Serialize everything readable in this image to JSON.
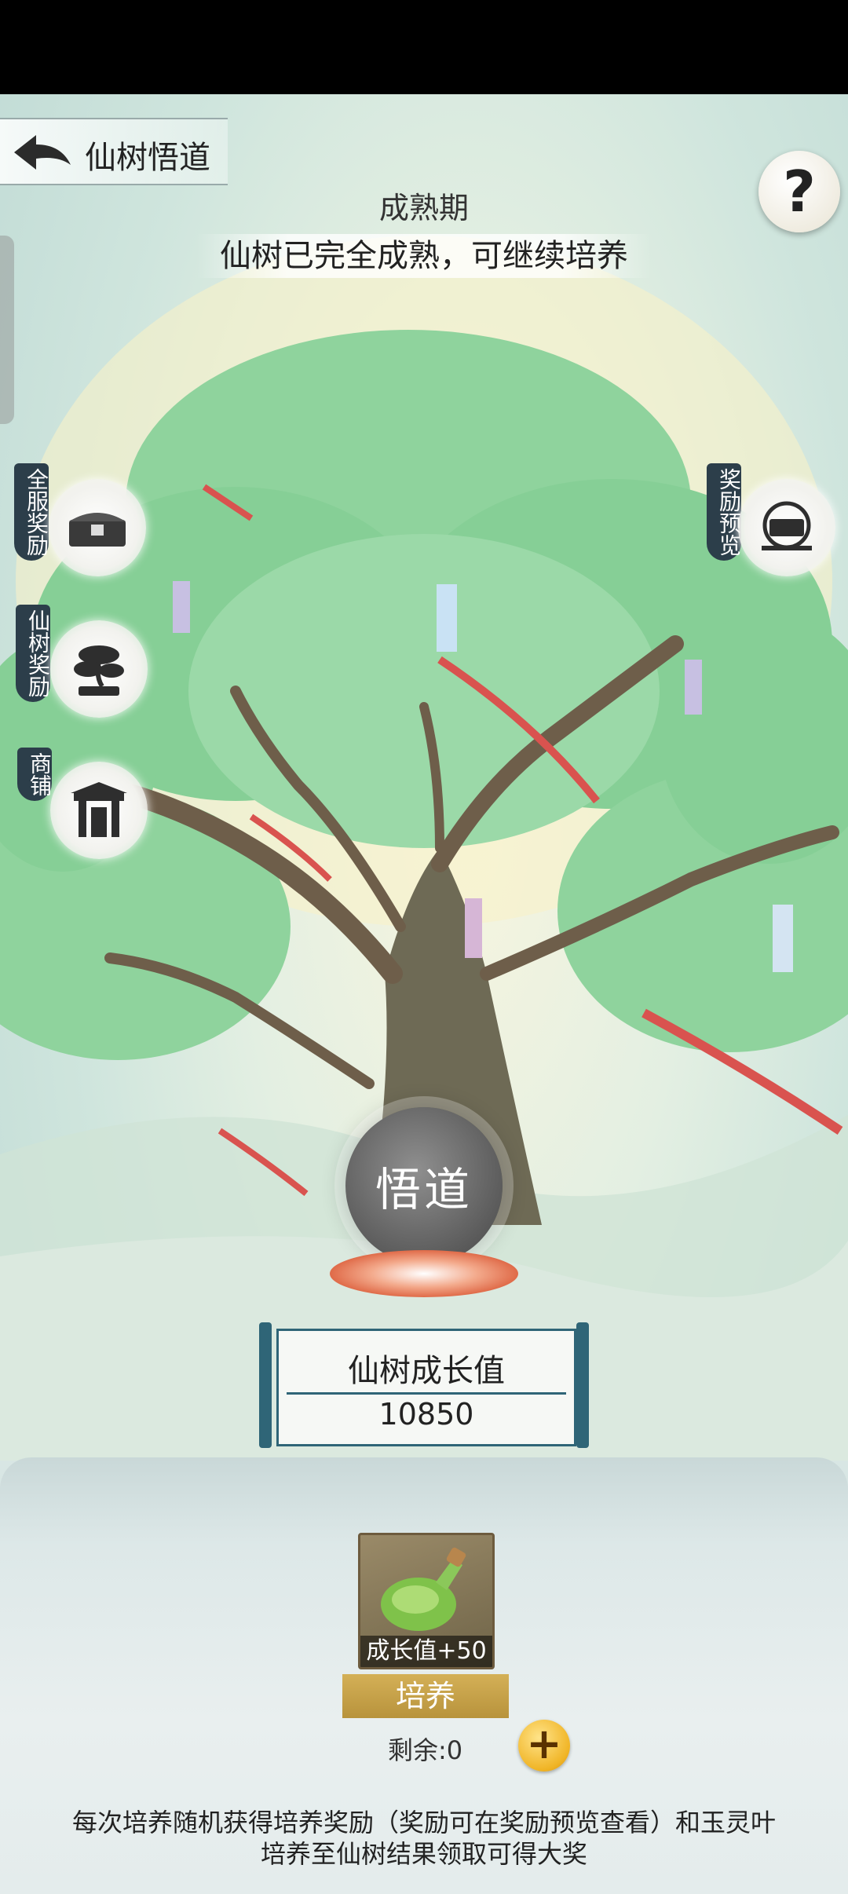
{
  "header": {
    "title": "仙树悟道",
    "help_label": "?"
  },
  "tree": {
    "stage": "成熟期",
    "stage_desc": "仙树已完全成熟，可继续培养"
  },
  "side_buttons": {
    "full_server": "全服奖励",
    "tree_reward": "仙树奖励",
    "shop": "商铺",
    "preview": "奖励预览"
  },
  "wudao_label": "悟道",
  "growth": {
    "label": "仙树成长值",
    "value": "10850"
  },
  "item": {
    "label": "成长值+50"
  },
  "cultivate_label": "培养",
  "remaining": "剩余:0",
  "plus_label": "+",
  "notes": {
    "line1": "每次培养随机获得培养奖励（奖励可在奖励预览查看）和玉灵叶",
    "line2": "培养至仙树结果领取可得大奖"
  }
}
